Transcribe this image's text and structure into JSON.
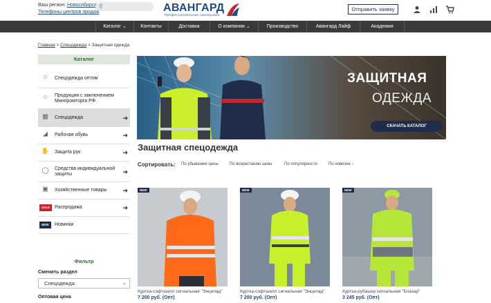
{
  "header": {
    "region_label": "Ваш регион:",
    "region_value": "Новосибирск",
    "phones_label": "Телефоны центров продаж",
    "logo_text": "АВАНГАРД",
    "logo_sub": "Профессиональная экипировка",
    "request_button": "Отправить заявку",
    "icons": [
      "user-icon",
      "stats-icon",
      "cart-icon"
    ]
  },
  "nav": {
    "items": [
      "Каталог",
      "Контакты",
      "Доставка",
      "О компании",
      "Производство",
      "Авангард Лайф",
      "Академия"
    ]
  },
  "breadcrumb": {
    "home": "Главная",
    "sep1": " > ",
    "cat": "Спецодежда",
    "sep2": " > ",
    "current": "Защитная одежда"
  },
  "sidebar": {
    "title": "Каталог",
    "items": [
      {
        "label": "Спецодежда оптом",
        "icon": "star-icon"
      },
      {
        "label": "Продукция с заключением Минпромторга РФ",
        "icon": "star-icon"
      },
      {
        "label": "Спецодежда",
        "icon": "vest-icon",
        "active": true
      },
      {
        "label": "Рабочая обувь",
        "icon": "boot-icon"
      },
      {
        "label": "Защита рук",
        "icon": "glove-icon"
      },
      {
        "label": "Средства индивидуальной защиты",
        "icon": "respirator-icon"
      },
      {
        "label": "Хозяйственные товары",
        "icon": "bucket-icon"
      },
      {
        "label": "Распродажа",
        "badge": "SALE",
        "badge_color": "#c0282d"
      },
      {
        "label": "Новинки",
        "badge": "NEW",
        "badge_color": "#1f2d4a"
      }
    ]
  },
  "filter": {
    "title": "Фильтр",
    "section_label": "Сменить раздел",
    "section_value": "Спецодежда",
    "price_label": "Оптовая цена"
  },
  "banner": {
    "line1": "ЗАЩИТНАЯ",
    "line2": "ОДЕЖДА",
    "button": "СКАЧАТЬ КАТАЛОГ"
  },
  "page": {
    "title": "Защитная спецодежда"
  },
  "sort": {
    "label": "Сортировать:",
    "options": [
      "По убыванию цены",
      "По возрастанию цены",
      "По популярности",
      "По новизне ↓"
    ]
  },
  "products": [
    {
      "badge": "NEW",
      "name": "Куртка-софтшелл сигнальная \"Энцелад\"",
      "price": "7 200 руб. (Опт)",
      "color": "#ff6a1a"
    },
    {
      "badge": "NEW",
      "name": "Куртка-софтшелл сигнальная \"Энцелад\"",
      "price": "7 200 руб. (Опт)",
      "color": "#c8f02a"
    },
    {
      "badge": "NEW",
      "name": "Куртка-рубашка сигнальная \"Блазар\"",
      "price": "3 245 руб. (Опт)",
      "color": "#b7e63a"
    }
  ],
  "colors": {
    "accent": "#1f4a86",
    "nav": "#3a3a3a",
    "sidebar_title": "#2c6b2a",
    "sale": "#c0282d"
  }
}
